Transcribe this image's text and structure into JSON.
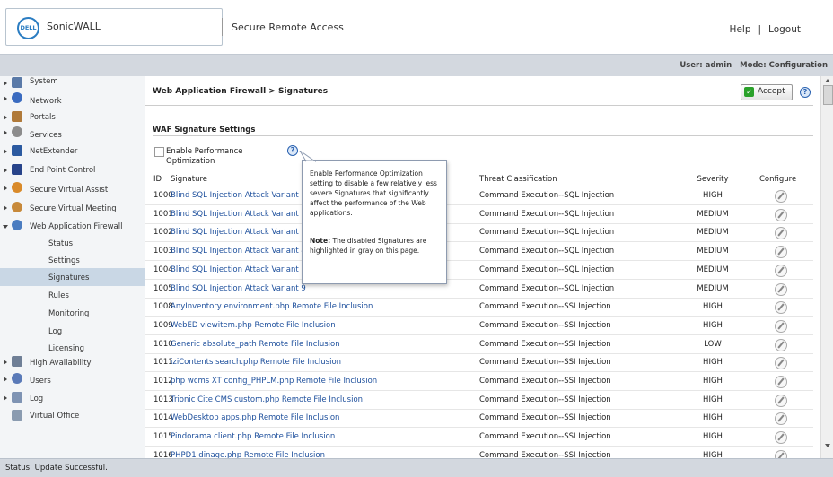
{
  "header": {
    "logo_text": "DELL",
    "brand": "SonicWALL",
    "product": "Secure Remote Access",
    "help": "Help",
    "sep": "|",
    "logout": "Logout"
  },
  "userbar": {
    "user_label": "User: admin",
    "mode_label": "Mode: Configuration"
  },
  "sidebar": {
    "items": [
      {
        "label": "System",
        "icon": "monitor-icon"
      },
      {
        "label": "Network",
        "icon": "globe-icon"
      },
      {
        "label": "Portals",
        "icon": "home-icon"
      },
      {
        "label": "Services",
        "icon": "gear-icon"
      },
      {
        "label": "NetExtender",
        "icon": "netextender-icon"
      },
      {
        "label": "End Point Control",
        "icon": "shield-icon"
      },
      {
        "label": "Secure Virtual Assist",
        "icon": "person-icon"
      },
      {
        "label": "Secure Virtual Meeting",
        "icon": "people-icon"
      },
      {
        "label": "Web Application Firewall",
        "icon": "firewall-icon"
      },
      {
        "label": "Status"
      },
      {
        "label": "Settings"
      },
      {
        "label": "Signatures"
      },
      {
        "label": "Rules"
      },
      {
        "label": "Monitoring"
      },
      {
        "label": "Log"
      },
      {
        "label": "Licensing"
      },
      {
        "label": "High Availability",
        "icon": "servers-icon"
      },
      {
        "label": "Users",
        "icon": "users-icon"
      },
      {
        "label": "Log",
        "icon": "log-icon"
      },
      {
        "label": "Virtual Office",
        "icon": "building-icon"
      }
    ]
  },
  "main": {
    "breadcrumb": "Web Application Firewall > Signatures",
    "accept_label": "Accept",
    "help_glyph": "?",
    "section_title": "WAF Signature Settings",
    "perf_label": "Enable Performance Optimization",
    "columns": {
      "id": "ID",
      "signature": "Signature",
      "threat": "Threat Classification",
      "severity": "Severity",
      "configure": "Configure"
    },
    "rows": [
      {
        "id": "1000",
        "signature": "Blind SQL Injection Attack Variant 1",
        "threat": "Command Execution--SQL Injection",
        "severity": "HIGH"
      },
      {
        "id": "1001",
        "signature": "Blind SQL Injection Attack Variant 2",
        "threat": "Command Execution--SQL Injection",
        "severity": "MEDIUM"
      },
      {
        "id": "1002",
        "signature": "Blind SQL Injection Attack Variant 3",
        "threat": "Command Execution--SQL Injection",
        "severity": "MEDIUM"
      },
      {
        "id": "1003",
        "signature": "Blind SQL Injection Attack Variant 4",
        "threat": "Command Execution--SQL Injection",
        "severity": "MEDIUM"
      },
      {
        "id": "1004",
        "signature": "Blind SQL Injection Attack Variant 5",
        "threat": "Command Execution--SQL Injection",
        "severity": "MEDIUM"
      },
      {
        "id": "1005",
        "signature": "Blind SQL Injection Attack Variant 9",
        "threat": "Command Execution--SQL Injection",
        "severity": "MEDIUM"
      },
      {
        "id": "1008",
        "signature": "AnyInventory environment.php Remote File Inclusion",
        "threat": "Command Execution--SSI Injection",
        "severity": "HIGH"
      },
      {
        "id": "1009",
        "signature": "WebED viewitem.php Remote File Inclusion",
        "threat": "Command Execution--SSI Injection",
        "severity": "HIGH"
      },
      {
        "id": "1010",
        "signature": "Generic absolute_path Remote File Inclusion",
        "threat": "Command Execution--SSI Injection",
        "severity": "LOW"
      },
      {
        "id": "1011",
        "signature": "iziContents search.php Remote File Inclusion",
        "threat": "Command Execution--SSI Injection",
        "severity": "HIGH"
      },
      {
        "id": "1012",
        "signature": "php wcms XT config_PHPLM.php Remote File Inclusion",
        "threat": "Command Execution--SSI Injection",
        "severity": "HIGH"
      },
      {
        "id": "1013",
        "signature": "Trionic Cite CMS custom.php Remote File Inclusion",
        "threat": "Command Execution--SSI Injection",
        "severity": "HIGH"
      },
      {
        "id": "1014",
        "signature": "WebDesktop apps.php Remote File Inclusion",
        "threat": "Command Execution--SSI Injection",
        "severity": "HIGH"
      },
      {
        "id": "1015",
        "signature": "Pindorama client.php Remote File Inclusion",
        "threat": "Command Execution--SSI Injection",
        "severity": "HIGH"
      },
      {
        "id": "1016",
        "signature": "PHPD1 dinage.php Remote File Inclusion",
        "threat": "Command Execution--SSI Injection",
        "severity": "HIGH"
      }
    ]
  },
  "tooltip": {
    "text": "Enable Performance Optimization setting to disable a few relatively less severe Signatures that significantly affect the performance of the Web applications.",
    "note_label": "Note:",
    "note_text": " The disabled Signatures are highlighted in gray on this page."
  },
  "status": {
    "text": "Status: Update Successful."
  }
}
